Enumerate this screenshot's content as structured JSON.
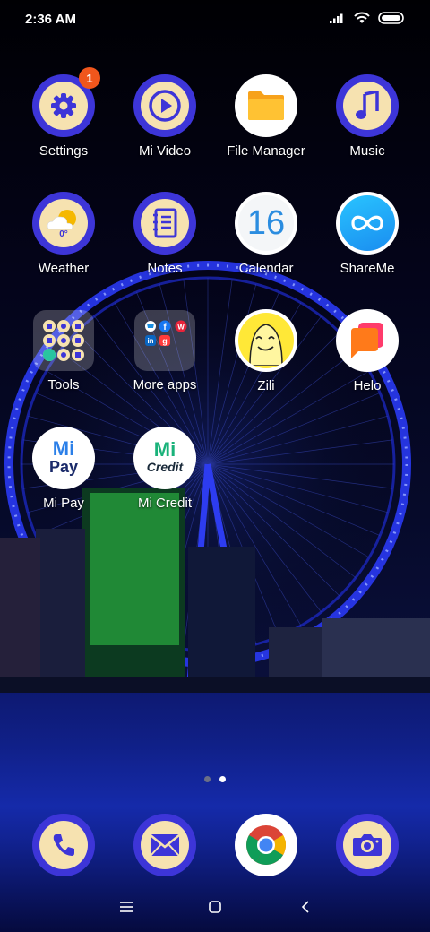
{
  "status": {
    "time": "2:36 AM"
  },
  "apps": [
    {
      "label": "Settings",
      "badge": "1"
    },
    {
      "label": "Mi Video"
    },
    {
      "label": "File Manager"
    },
    {
      "label": "Music"
    },
    {
      "label": "Weather",
      "temp": "0°"
    },
    {
      "label": "Notes"
    },
    {
      "label": "Calendar",
      "day": "16"
    },
    {
      "label": "ShareMe"
    },
    {
      "label": "Tools"
    },
    {
      "label": "More apps"
    },
    {
      "label": "Zili"
    },
    {
      "label": "Helo"
    },
    {
      "label": "Mi Pay",
      "logo_top": "Mi",
      "logo_bottom": "Pay"
    },
    {
      "label": "Mi Credit",
      "logo_top": "Mi",
      "logo_bottom": "Credit"
    }
  ],
  "page_indicator": {
    "pages": 2,
    "current": 2
  },
  "dock": [
    "phone-icon",
    "messages-icon",
    "chrome-icon",
    "camera-icon"
  ],
  "colors": {
    "accent_purple": "#3d35d8",
    "icon_cream": "#f6e2b0",
    "badge": "#f0561c"
  }
}
